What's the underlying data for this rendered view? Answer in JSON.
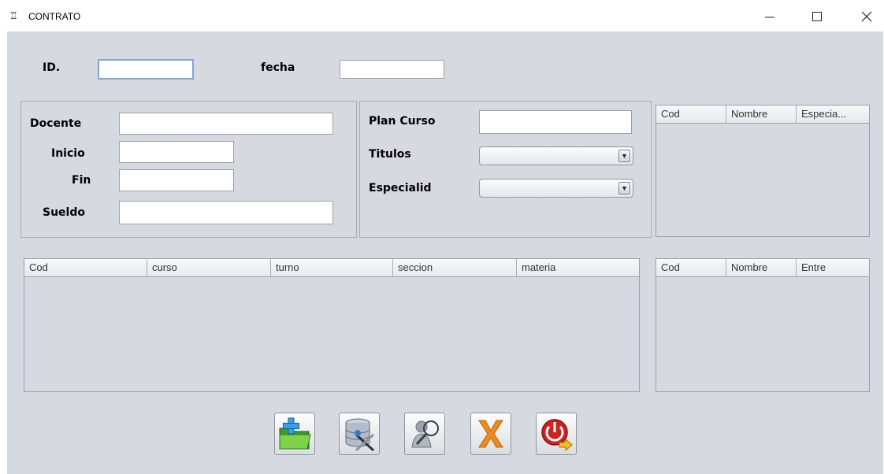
{
  "window": {
    "title": "CONTRATO",
    "app_icon": "java-icon"
  },
  "form": {
    "id_label": "ID.",
    "id_value": "",
    "fecha_label": "fecha",
    "fecha_value": "",
    "docente_label": "Docente",
    "docente_value": "",
    "inicio_label": "Inicio",
    "inicio_value": "",
    "fin_label": "Fin",
    "fin_value": "",
    "sueldo_label": "Sueldo",
    "sueldo_value": "",
    "plan_curso_label": "Plan Curso",
    "plan_curso_value": "",
    "titulos_label": "Titulos",
    "titulos_selected": "",
    "especialid_label": "Especialid",
    "especialid_selected": ""
  },
  "tables": {
    "docentes": {
      "columns": [
        "Cod",
        "Nombre",
        "Especia..."
      ],
      "rows": []
    },
    "cursos": {
      "columns": [
        "Cod",
        "curso",
        "turno",
        "seccion",
        "materia"
      ],
      "rows": []
    },
    "titulos": {
      "columns": [
        "Cod",
        "Nombre",
        "Entre"
      ],
      "rows": []
    }
  },
  "toolbar": {
    "buttons": [
      "new-icon",
      "database-tools-icon",
      "search-user-icon",
      "delete-icon",
      "exit-icon"
    ]
  }
}
